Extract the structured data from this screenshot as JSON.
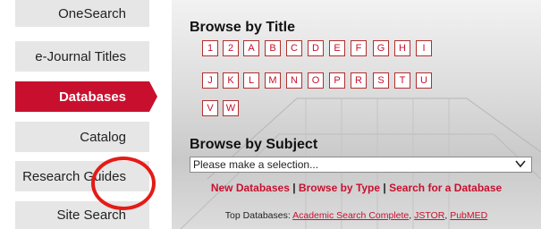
{
  "nav": {
    "items": [
      {
        "label": "OneSearch",
        "active": false
      },
      {
        "label": "e-Journal Titles",
        "active": false
      },
      {
        "label": "Databases",
        "active": true
      },
      {
        "label": "Catalog",
        "active": false
      },
      {
        "label": "Research Guides",
        "active": false
      },
      {
        "label": "Site Search",
        "active": false
      }
    ]
  },
  "browse_title": {
    "heading": "Browse by Title",
    "letters": [
      "1",
      "2",
      "A",
      "B",
      "C",
      "D",
      "E",
      "F",
      "G",
      "H",
      "I",
      "J",
      "K",
      "L",
      "M",
      "N",
      "O",
      "P",
      "R",
      "S",
      "T",
      "U",
      "V",
      "W"
    ]
  },
  "browse_subject": {
    "heading": "Browse by Subject",
    "select_value": "Please make a selection..."
  },
  "links": {
    "new_databases": "New Databases",
    "separator": "|",
    "browse_by_type": "Browse by Type",
    "search_database": "Search for a Database"
  },
  "top_databases": {
    "label": "Top Databases:",
    "items": [
      "Academic Search Complete",
      "JSTOR",
      "PubMED"
    ]
  },
  "colors": {
    "accent": "#c8102e",
    "highlight_circle": "#e41b17"
  }
}
